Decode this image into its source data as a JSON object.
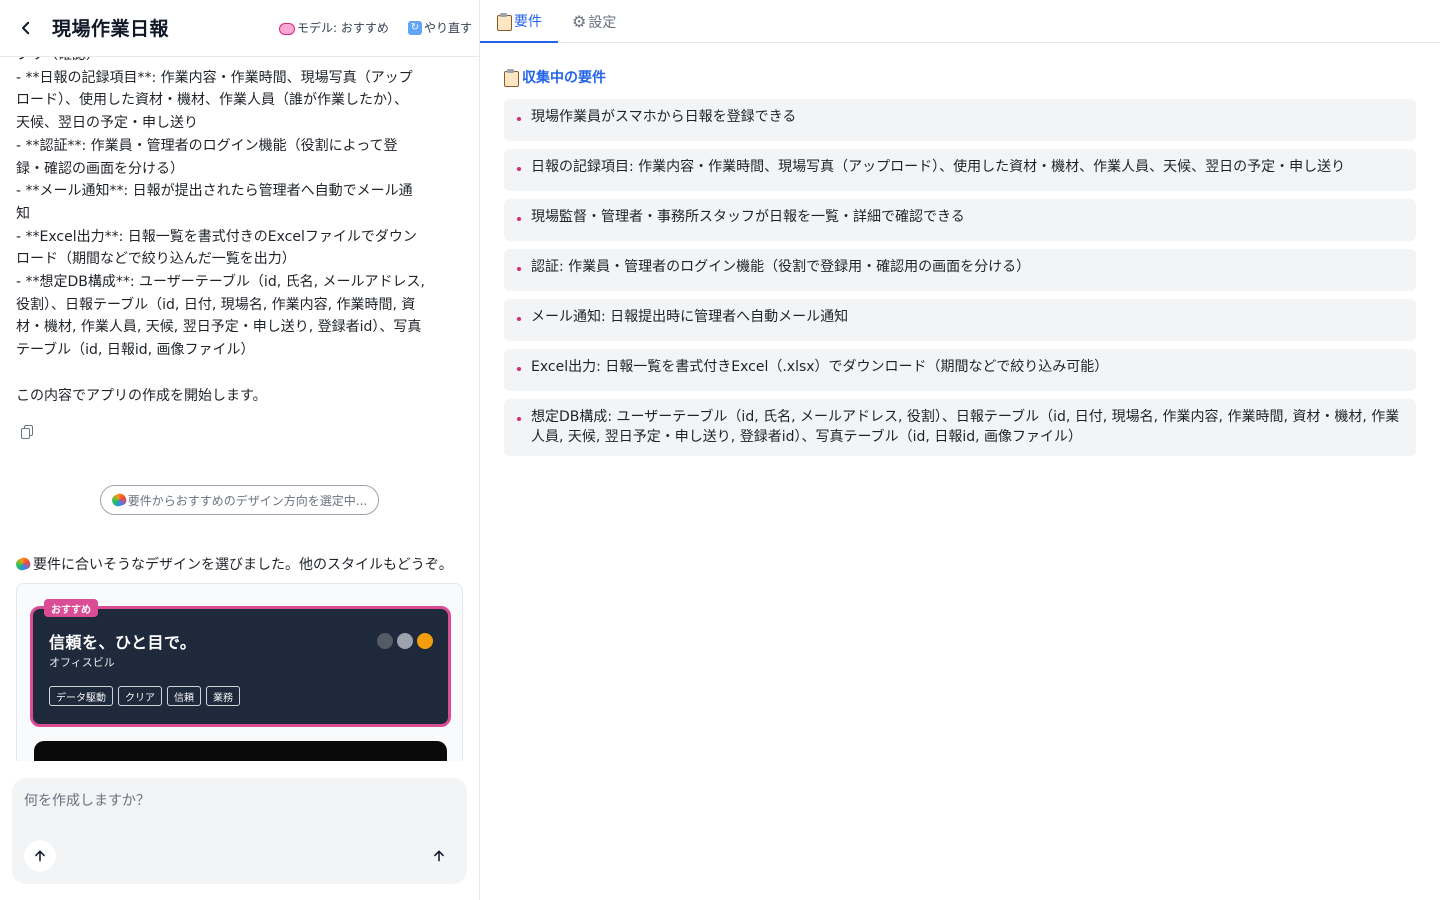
{
  "header": {
    "back_label": "戻る",
    "title": "現場作業日報",
    "model_label": "モデル: おすすめ",
    "redo_label": "やり直す"
  },
  "chat": {
    "lines": [
      "プリ（確認）",
      "- **日報の記録項目**: 作業内容・作業時間、現場写真（アップ",
      "ロード）、使用した資材・機材、作業人員（誰が作業したか）、",
      "天候、翌日の予定・申し送り",
      "- **認証**: 作業員・管理者のログイン機能（役割によって登",
      "録・確認の画面を分ける）",
      "- **メール通知**: 日報が提出されたら管理者へ自動でメール通",
      "知",
      "- **Excel出力**: 日報一覧を書式付きのExcelファイルでダウン",
      "ロード（期間などで絞り込んだ一覧を出力）",
      "- **想定DB構成**: ユーザーテーブル（id, 氏名, メールアドレス,",
      "役割）、日報テーブル（id, 日付, 現場名, 作業内容, 作業時間, 資",
      "材・機材, 作業人員, 天候, 翌日予定・申し送り, 登録者id）、写真",
      "テーブル（id, 日報id, 画像ファイル）",
      "",
      "この内容でアプリの作成を開始します。"
    ],
    "suggest_pill": "要件からおすすめのデザイン方向を選定中...",
    "design_intro": "要件に合いそうなデザインを選びました。他のスタイルもどうぞ。"
  },
  "design_card": {
    "badge": "おすすめ",
    "title": "信頼を、ひと目で。",
    "subtitle": "オフィスビル",
    "swatches": [
      "#555b66",
      "#9ca3af",
      "#f59e0b"
    ],
    "tags": [
      "データ駆動",
      "クリア",
      "信頼",
      "業務"
    ]
  },
  "composer": {
    "placeholder": "何を作成しますか？"
  },
  "tabs": [
    {
      "label": "要件",
      "icon": "clipboard-icon",
      "active": true
    },
    {
      "label": "設定",
      "icon": "gear-icon",
      "active": false
    }
  ],
  "requirements": {
    "section_title": "収集中の要件",
    "items": [
      "現場作業員がスマホから日報を登録できる",
      "日報の記録項目: 作業内容・作業時間、現場写真（アップロード）、使用した資材・機材、作業人員、天候、翌日の予定・申し送り",
      "現場監督・管理者・事務所スタッフが日報を一覧・詳細で確認できる",
      "認証: 作業員・管理者のログイン機能（役割で登録用・確認用の画面を分ける）",
      "メール通知: 日報提出時に管理者へ自動メール通知",
      "Excel出力: 日報一覧を書式付きExcel（.xlsx）でダウンロード（期間などで絞り込み可能）",
      "想定DB構成: ユーザーテーブル（id, 氏名, メールアドレス, 役割）、日報テーブル（id, 日付, 現場名, 作業内容, 作業時間, 資材・機材, 作業人員, 天候, 翌日予定・申し送り, 登録者id）、写真テーブル（id, 日報id, 画像ファイル）"
    ]
  },
  "colors": {
    "accent": "#2563eb",
    "recommend_border": "#db4c96",
    "card_bg": "#1e293b",
    "bullet": "#db2777"
  }
}
